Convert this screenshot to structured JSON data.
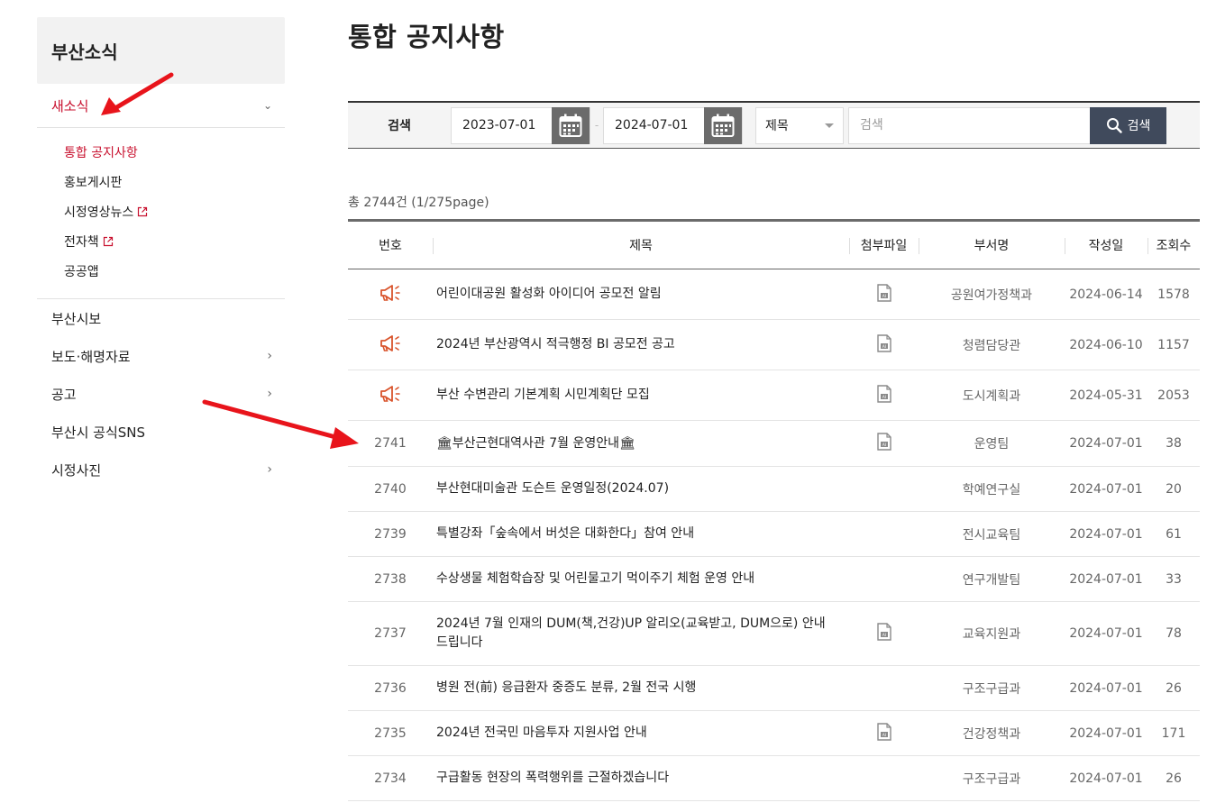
{
  "sidebar": {
    "header": "부산소식",
    "active_menu": "새소식",
    "submenu": [
      {
        "label": "통합 공지사항",
        "current": true,
        "external": false
      },
      {
        "label": "홍보게시판",
        "current": false,
        "external": false
      },
      {
        "label": "시정영상뉴스",
        "current": false,
        "external": true
      },
      {
        "label": "전자책",
        "current": false,
        "external": true
      },
      {
        "label": "공공앱",
        "current": false,
        "external": false
      }
    ],
    "menu": [
      {
        "label": "부산시보",
        "has_children": false
      },
      {
        "label": "보도·해명자료",
        "has_children": true
      },
      {
        "label": "공고",
        "has_children": true
      },
      {
        "label": "부산시 공식SNS",
        "has_children": false
      },
      {
        "label": "시정사진",
        "has_children": true
      }
    ]
  },
  "page": {
    "title": "통합 공지사항"
  },
  "search": {
    "label": "검색",
    "start_date": "2023-07-01",
    "end_date": "2024-07-01",
    "field": "제목",
    "placeholder": "검색",
    "button": "검색"
  },
  "summary": "총 2744건 (1/275page)",
  "table": {
    "headers": [
      "번호",
      "제목",
      "첨부파일",
      "부서명",
      "작성일",
      "조회수"
    ],
    "rows": [
      {
        "no": "",
        "notice": true,
        "title": "어린이대공원 활성화 아이디어 공모전 알림",
        "attachment": true,
        "dept": "공원여가정책과",
        "date": "2024-06-14",
        "views": "1578"
      },
      {
        "no": "",
        "notice": true,
        "title": "2024년 부산광역시 적극행정 BI 공모전 공고",
        "attachment": true,
        "dept": "청렴담당관",
        "date": "2024-06-10",
        "views": "1157"
      },
      {
        "no": "",
        "notice": true,
        "title": "부산 수변관리 기본계획 시민계획단 모집",
        "attachment": true,
        "dept": "도시계획과",
        "date": "2024-05-31",
        "views": "2053"
      },
      {
        "no": "2741",
        "notice": false,
        "title": "🏛부산근현대역사관 7월 운영안내🏛",
        "attachment": true,
        "dept": "운영팀",
        "date": "2024-07-01",
        "views": "38"
      },
      {
        "no": "2740",
        "notice": false,
        "title": "부산현대미술관 도슨트 운영일정(2024.07)",
        "attachment": false,
        "dept": "학예연구실",
        "date": "2024-07-01",
        "views": "20"
      },
      {
        "no": "2739",
        "notice": false,
        "title": "특별강좌「숲속에서 버섯은 대화한다」참여 안내",
        "attachment": false,
        "dept": "전시교육팀",
        "date": "2024-07-01",
        "views": "61"
      },
      {
        "no": "2738",
        "notice": false,
        "title": "수상생물 체험학습장 및 어린물고기 먹이주기 체험 운영 안내",
        "attachment": false,
        "dept": "연구개발팀",
        "date": "2024-07-01",
        "views": "33"
      },
      {
        "no": "2737",
        "notice": false,
        "title": "2024년 7월 인재의 DUM(책,건강)UP 알리오(교육받고, DUM으로) 안내 드립니다",
        "attachment": true,
        "dept": "교육지원과",
        "date": "2024-07-01",
        "views": "78"
      },
      {
        "no": "2736",
        "notice": false,
        "title": "병원 전(前) 응급환자 중증도 분류, 2월 전국 시행",
        "attachment": false,
        "dept": "구조구급과",
        "date": "2024-07-01",
        "views": "26"
      },
      {
        "no": "2735",
        "notice": false,
        "title": "2024년 전국민 마음투자 지원사업 안내",
        "attachment": true,
        "dept": "건강정책과",
        "date": "2024-07-01",
        "views": "171"
      },
      {
        "no": "2734",
        "notice": false,
        "title": "구급활동 현장의 폭력행위를 근절하겠습니다",
        "attachment": false,
        "dept": "구조구급과",
        "date": "2024-07-01",
        "views": "26"
      }
    ]
  },
  "colors": {
    "accent": "#c8102e",
    "arrow": "#e8141b",
    "search_button": "#404a5c",
    "notice_icon": "#d9542c"
  },
  "icons": {
    "notice": "megaphone-icon",
    "attachment": "attachment-file-icon",
    "calendar": "calendar-icon",
    "search": "search-icon"
  }
}
